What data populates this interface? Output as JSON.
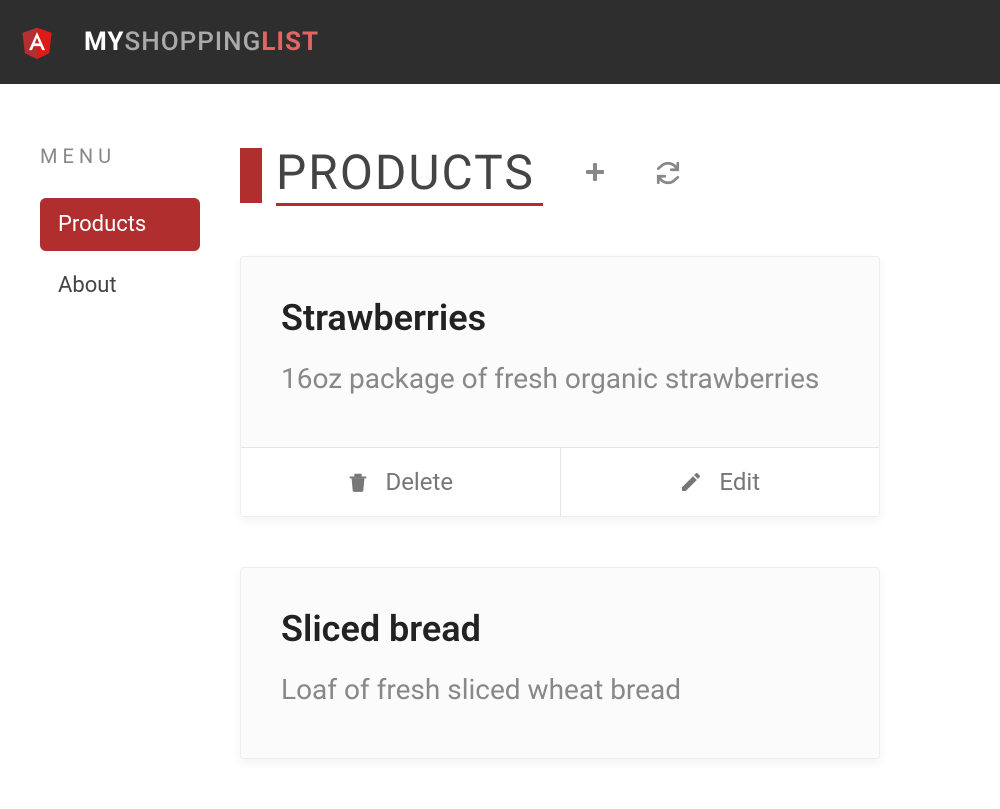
{
  "brand": {
    "part1": "MY",
    "part2": "SHOPPING",
    "part3": "LIST"
  },
  "sidebar": {
    "label": "MENU",
    "items": [
      {
        "label": "Products",
        "active": true
      },
      {
        "label": "About",
        "active": false
      }
    ]
  },
  "page": {
    "title": "PRODUCTS"
  },
  "actions": {
    "delete": "Delete",
    "edit": "Edit"
  },
  "products": [
    {
      "title": "Strawberries",
      "desc": "16oz package of fresh organic strawberries"
    },
    {
      "title": "Sliced bread",
      "desc": "Loaf of fresh sliced wheat bread"
    }
  ]
}
